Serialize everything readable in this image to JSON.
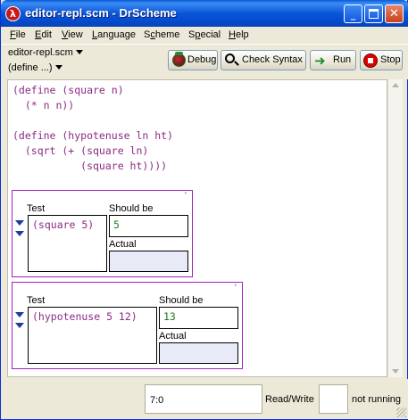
{
  "window": {
    "title": "editor-repl.scm - DrScheme",
    "icon_glyph": "λ",
    "minimize_glyph": "_",
    "close_glyph": "✕"
  },
  "menu": {
    "items": [
      {
        "label": "File",
        "mnemonic": "F"
      },
      {
        "label": "Edit",
        "mnemonic": "E"
      },
      {
        "label": "View",
        "mnemonic": "V"
      },
      {
        "label": "Language",
        "mnemonic": "L"
      },
      {
        "label": "Scheme",
        "mnemonic": "c"
      },
      {
        "label": "Special",
        "mnemonic": "p"
      },
      {
        "label": "Help",
        "mnemonic": "H"
      }
    ]
  },
  "toolbar": {
    "file_selector": "editor-repl.scm",
    "define_selector": "(define ...)",
    "debug_label": "Debug",
    "check_syntax_label": "Check Syntax",
    "run_label": "Run",
    "stop_label": "Stop",
    "run_icon": "running-man-icon",
    "debug_icon": "bug-icon",
    "check_icon": "magnifier-icon",
    "stop_icon": "stop-sign-icon"
  },
  "editor": {
    "lines": [
      "(define (square n)",
      "  (* n n))",
      "",
      "(define (hypotenuse ln ht)",
      "  (sqrt (+ (square ln)",
      "           (square ht))))"
    ]
  },
  "tests": [
    {
      "test_label": "Test",
      "should_be_label": "Should be",
      "actual_label": "Actual",
      "test_expr": "(square 5)",
      "expected": "5",
      "actual": "",
      "corner_mark": "'"
    },
    {
      "test_label": "Test",
      "should_be_label": "Should be",
      "actual_label": "Actual",
      "test_expr": "(hypotenuse 5 12)",
      "expected": "13",
      "actual": "",
      "corner_mark": "'"
    }
  ],
  "status": {
    "position": "7:0",
    "mode": "Read/Write",
    "state": "not running"
  },
  "colors": {
    "keyword": "#8c2a84",
    "number": "#1e7a1e",
    "test_border": "#a020c0"
  }
}
